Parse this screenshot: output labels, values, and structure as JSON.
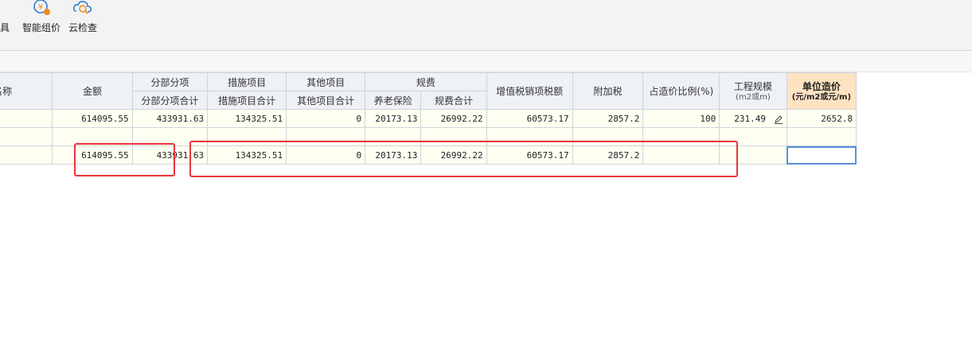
{
  "toolbar": {
    "partial_label": "具",
    "smart_price_label": "智能组价",
    "cloud_check_label": "云检查"
  },
  "table": {
    "headers": {
      "name": "名称",
      "amount": "金额",
      "fbfx": "分部分项",
      "fbfx_sub": "分部分项合计",
      "csxm": "措施项目",
      "csxm_sub": "措施项目合计",
      "qtxm": "其他项目",
      "qtxm_sub": "其他项目合计",
      "gf": "规费",
      "ylbx": "养老保险",
      "gfhj": "规费合计",
      "vat": "增值税销项税额",
      "surtax": "附加税",
      "ratio": "占造价比例(%)",
      "scale": "工程规模",
      "scale_unit": "(m2或m)",
      "unit_cost": "单位造价",
      "unit_cost_unit": "(元/m2或元/m)"
    },
    "rows": [
      {
        "amount": "614095.55",
        "fbfx": "433931.63",
        "csxm": "134325.51",
        "qtxm": "0",
        "ylbx": "20173.13",
        "gfhj": "26992.22",
        "vat": "60573.17",
        "surtax": "2857.2",
        "ratio": "100",
        "scale": "231.49",
        "unit_cost": "2652.8"
      },
      {
        "amount": "614095.55",
        "fbfx": "433931.63",
        "csxm": "134325.51",
        "qtxm": "0",
        "ylbx": "20173.13",
        "gfhj": "26992.22",
        "vat": "60573.17",
        "surtax": "2857.2",
        "ratio": "",
        "scale": "",
        "unit_cost": ""
      }
    ]
  },
  "colors": {
    "highlight": "#e8343a",
    "unit_header": "#fde3c2",
    "cell_bg": "#fffff2"
  }
}
